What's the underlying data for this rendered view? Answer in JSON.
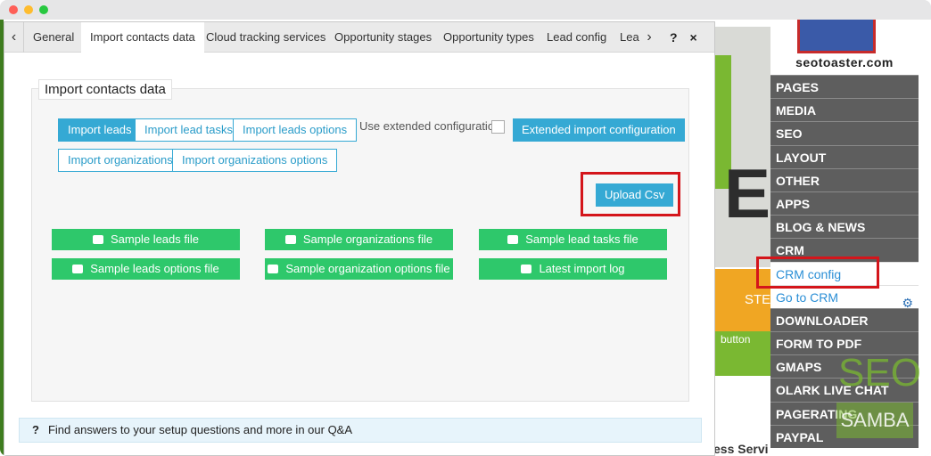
{
  "dialog": {
    "tabs": [
      {
        "label": "General"
      },
      {
        "label": "Import contacts data"
      },
      {
        "label": "Cloud tracking services"
      },
      {
        "label": "Opportunity stages"
      },
      {
        "label": "Opportunity types"
      },
      {
        "label": "Lead config"
      },
      {
        "label": "Lea"
      }
    ],
    "tab_prev": "‹",
    "tab_next": "›",
    "help_label": "?",
    "close_label": "×",
    "panel_title": "Import contacts data",
    "import_tabs": [
      {
        "label": "Import leads"
      },
      {
        "label": "Import lead tasks"
      },
      {
        "label": "Import leads options"
      },
      {
        "label": "Import organizations"
      },
      {
        "label": "Import organizations options"
      }
    ],
    "extended_label": "Use extended configuration:",
    "extended_button": "Extended import configuration",
    "upload_button": "Upload Csv",
    "sample_buttons": [
      {
        "label": "Sample leads file"
      },
      {
        "label": "Sample organizations file"
      },
      {
        "label": "Sample lead tasks file"
      },
      {
        "label": "Sample leads options file"
      },
      {
        "label": "Sample organization options file"
      },
      {
        "label": "Latest import log"
      }
    ],
    "help_bar": {
      "icon": "?",
      "text": "Find answers to your setup questions and more in our Q&A"
    }
  },
  "site": {
    "logo_text": "seotoaster.com",
    "menu": [
      {
        "label": "PAGES"
      },
      {
        "label": "MEDIA"
      },
      {
        "label": "SEO"
      },
      {
        "label": "LAYOUT"
      },
      {
        "label": "OTHER"
      },
      {
        "label": "APPS"
      },
      {
        "label": "BLOG & NEWS"
      },
      {
        "label": "CRM"
      },
      {
        "label": "CRM config"
      },
      {
        "label": "Go to CRM"
      },
      {
        "label": "DOWNLOADER"
      },
      {
        "label": "FORM TO PDF"
      },
      {
        "label": "GMAPS"
      },
      {
        "label": "OLARK LIVE CHAT"
      },
      {
        "label": "PAGERATING"
      },
      {
        "label": "PAYPAL"
      }
    ],
    "hero_letter": "E",
    "orange_text": "STE",
    "green_text": "button",
    "bottom_text": "ess Servi",
    "watermark_top": "SEO",
    "watermark_bottom": "SAMBA"
  },
  "colors": {
    "accent": "#35a9d4",
    "green": "#2ec86b",
    "highlight": "#d4151b",
    "menu_bg": "#5e5e5e"
  }
}
